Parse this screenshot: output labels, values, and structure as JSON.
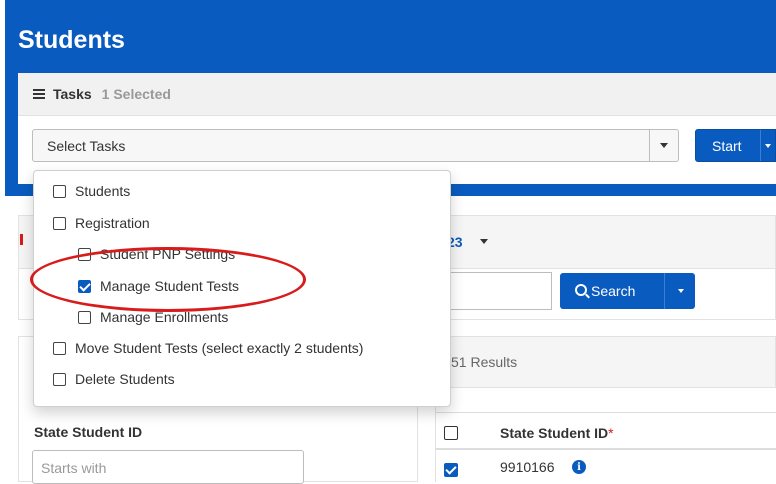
{
  "page": {
    "title": "Students"
  },
  "tasks": {
    "header_title": "Tasks",
    "selected_count": "1 Selected",
    "select_value": "Select Tasks",
    "start_label": "Start"
  },
  "dropdown": {
    "options": [
      {
        "label": "Students",
        "checked": false
      },
      {
        "label": "Registration",
        "checked": false
      },
      {
        "label": "Student PNP Settings",
        "checked": false
      },
      {
        "label": "Manage Student Tests",
        "checked": true
      },
      {
        "label": "Manage Enrollments",
        "checked": false
      },
      {
        "label": "Move Student Tests (select exactly 2 students)",
        "checked": false
      },
      {
        "label": "Delete Students",
        "checked": false
      }
    ]
  },
  "filter": {
    "peek_link": "23",
    "search_label": "Search",
    "results_text": "51 Results",
    "state_id_label": "State Student ID",
    "state_id_placeholder": "Starts with"
  },
  "table": {
    "column_header": "State Student ID",
    "required_mark": "*",
    "rows": [
      {
        "state_id": "9910166",
        "checked": true
      }
    ]
  },
  "colors": {
    "accent": "#0a5bbf",
    "highlight": "#d81b1b"
  }
}
